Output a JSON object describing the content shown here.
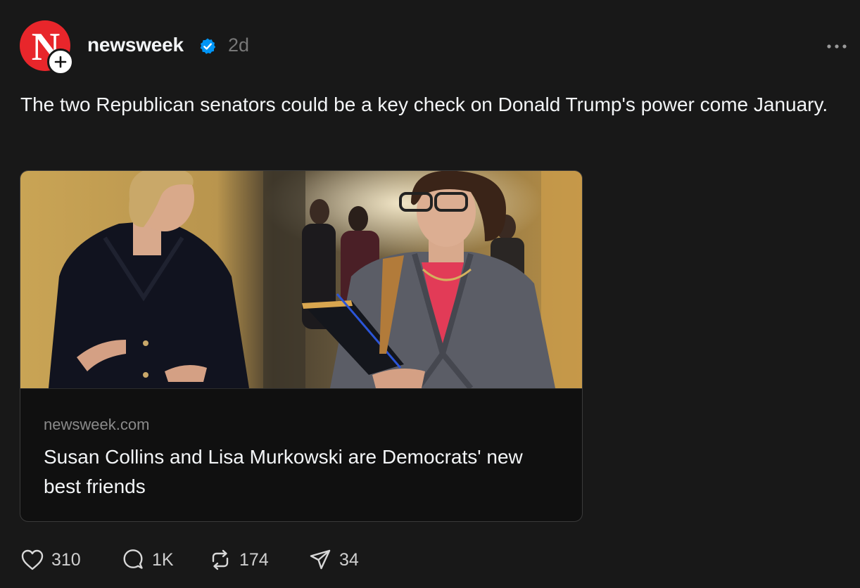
{
  "author": {
    "avatar_letter": "N",
    "username": "newsweek",
    "time_ago": "2d"
  },
  "post": {
    "caption": "The two Republican senators could be a key check on Donald Trump's power come January."
  },
  "link_card": {
    "domain": "newsweek.com",
    "title": "Susan Collins and Lisa Murkowski are Democrats' new best friends"
  },
  "actions": {
    "likes": "310",
    "replies": "1K",
    "reposts": "174",
    "shares": "34"
  },
  "icons": [
    "plus-icon",
    "verified-badge-icon",
    "more-icon",
    "heart-icon",
    "comment-icon",
    "repost-icon",
    "send-icon"
  ],
  "colors": {
    "background": "#181818",
    "brand_red": "#e8262b",
    "verified_blue": "#0095f6",
    "secondary_text": "#777777"
  }
}
